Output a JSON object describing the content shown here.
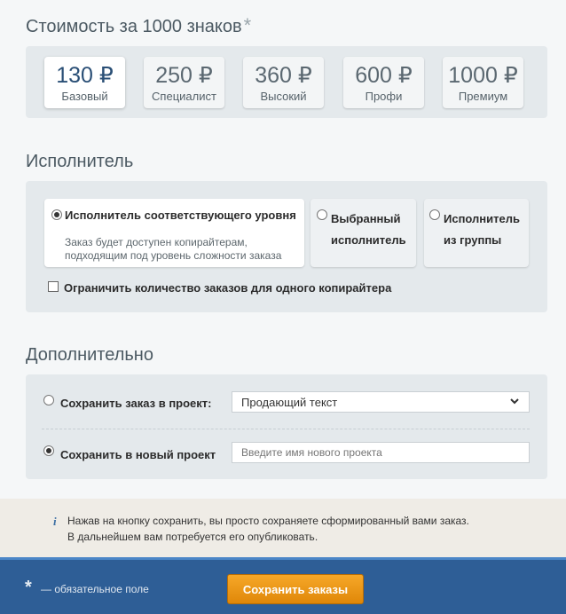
{
  "price_section": {
    "title": "Стоимость за 1000 знаков",
    "required_mark": "*",
    "options": [
      {
        "price": "130 ₽",
        "label": "Базовый",
        "selected": true
      },
      {
        "price": "250 ₽",
        "label": "Специалист",
        "selected": false
      },
      {
        "price": "360 ₽",
        "label": "Высокий",
        "selected": false
      },
      {
        "price": "600 ₽",
        "label": "Профи",
        "selected": false
      },
      {
        "price": "1000 ₽",
        "label": "Премиум",
        "selected": false
      }
    ]
  },
  "executor_section": {
    "title": "Исполнитель",
    "options": [
      {
        "title": "Исполнитель соответствующего уровня",
        "description": "Заказ будет доступен копирайтерам, подходящим под уровень сложности заказа",
        "selected": true
      },
      {
        "title_line1": "Выбранный",
        "title_line2": "исполнитель",
        "selected": false
      },
      {
        "title_line1": "Исполнитель",
        "title_line2": "из группы",
        "selected": false
      }
    ],
    "limit_checkbox": {
      "label": "Ограничить количество заказов для одного копирайтера",
      "checked": false
    }
  },
  "extra_section": {
    "title": "Дополнительно",
    "save_to_project": {
      "label": "Сохранить заказ в проект:",
      "selected_value": "Продающий текст",
      "checked": false
    },
    "save_new_project": {
      "label": "Сохранить в новый проект",
      "placeholder": "Введите имя нового проекта",
      "checked": true
    }
  },
  "info": {
    "icon": "info-icon",
    "line1": "Нажав на кнопку сохранить, вы просто сохраняете сформированный вами заказ.",
    "line2": "В дальнейшем вам потребуется его опубликовать."
  },
  "footer": {
    "required_star": "*",
    "required_text": "— обязательное поле",
    "save_button": "Сохранить заказы"
  },
  "colors": {
    "footer_bg": "#2e5e96",
    "button_orange": "#f09a1c",
    "panel_bg": "#e4e9ec"
  }
}
